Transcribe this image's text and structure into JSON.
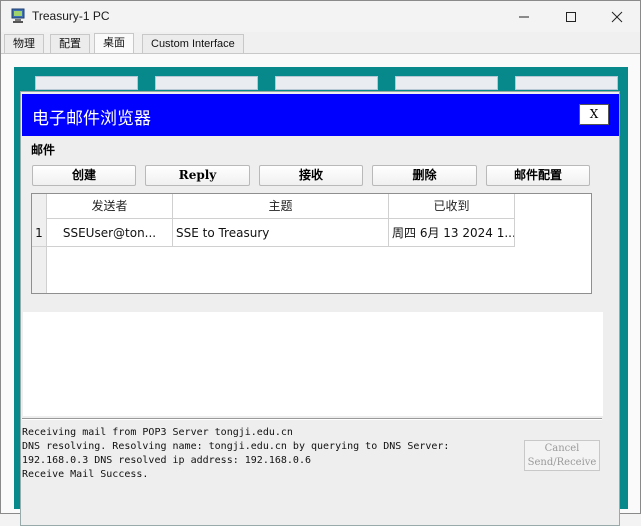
{
  "window": {
    "title": "Treasury-1 PC",
    "tabs": [
      "物理",
      "配置",
      "桌面",
      "Custom Interface"
    ],
    "active_tab": "桌面"
  },
  "mail_browser": {
    "title": "电子邮件浏览器",
    "close_label": "X",
    "group_label": "邮件",
    "buttons": {
      "compose": "创建",
      "reply": "Reply",
      "receive": "接收",
      "delete": "删除",
      "config": "邮件配置"
    },
    "table": {
      "columns": [
        "发送者",
        "主题",
        "已收到"
      ],
      "rows": [
        {
          "index": "1",
          "sender": "SSEUser@ton...",
          "subject": "SSE to Treasury",
          "received": "周四 6月 13 2024 1..."
        }
      ]
    },
    "log_lines": [
      "Receiving mail from POP3 Server tongji.edu.cn",
      "DNS resolving. Resolving name: tongji.edu.cn by querying to DNS Server:",
      "192.168.0.3  DNS resolved ip address: 192.168.0.6",
      "Receive Mail Success."
    ],
    "cancel_button": {
      "line1": "Cancel",
      "line2": "Send/Receive"
    }
  },
  "colors": {
    "header_blue": "#0000ff",
    "desktop_teal": "#07898c"
  }
}
